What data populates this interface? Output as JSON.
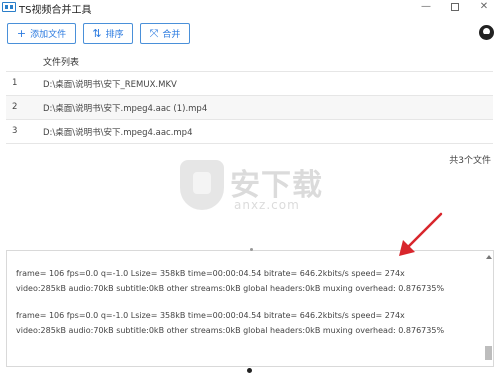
{
  "window": {
    "title": "TS视频合并工具",
    "minimize": "—",
    "close": "✕"
  },
  "toolbar": {
    "add_label": "添加文件",
    "add_icon": "+",
    "sort_label": "排序",
    "sort_icon": "⇅",
    "merge_label": "合并",
    "merge_icon": "⤧"
  },
  "file_table": {
    "header_name": "文件列表",
    "rows": [
      {
        "index": "1",
        "path": "D:\\桌面\\说明书\\安下_REMUX.MKV"
      },
      {
        "index": "2",
        "path": "D:\\桌面\\说明书\\安下.mpeg4.aac (1).mp4"
      },
      {
        "index": "3",
        "path": "D:\\桌面\\说明书\\安下.mpeg4.aac.mp4"
      }
    ],
    "count_text": "共3个文件"
  },
  "watermark": {
    "text": "安下载",
    "url": "anxz.com"
  },
  "log": {
    "lines": [
      "frame=   106 fps=0.0 q=-1.0 Lsize=      358kB time=00:00:04.54 bitrate= 646.2kbits/s speed= 274x",
      "video:285kB audio:70kB subtitle:0kB other streams:0kB global headers:0kB muxing overhead: 0.876735%",
      "frame=   106 fps=0.0 q=-1.0 Lsize=      358kB time=00:00:04.54 bitrate= 646.2kbits/s speed= 274x",
      "video:285kB audio:70kB subtitle:0kB other streams:0kB global headers:0kB muxing overhead: 0.876735%"
    ]
  },
  "colors": {
    "accent": "#2c7be0",
    "annotation_arrow": "#d8262c"
  },
  "icons": {
    "app": "app-icon",
    "github": "github-icon"
  }
}
